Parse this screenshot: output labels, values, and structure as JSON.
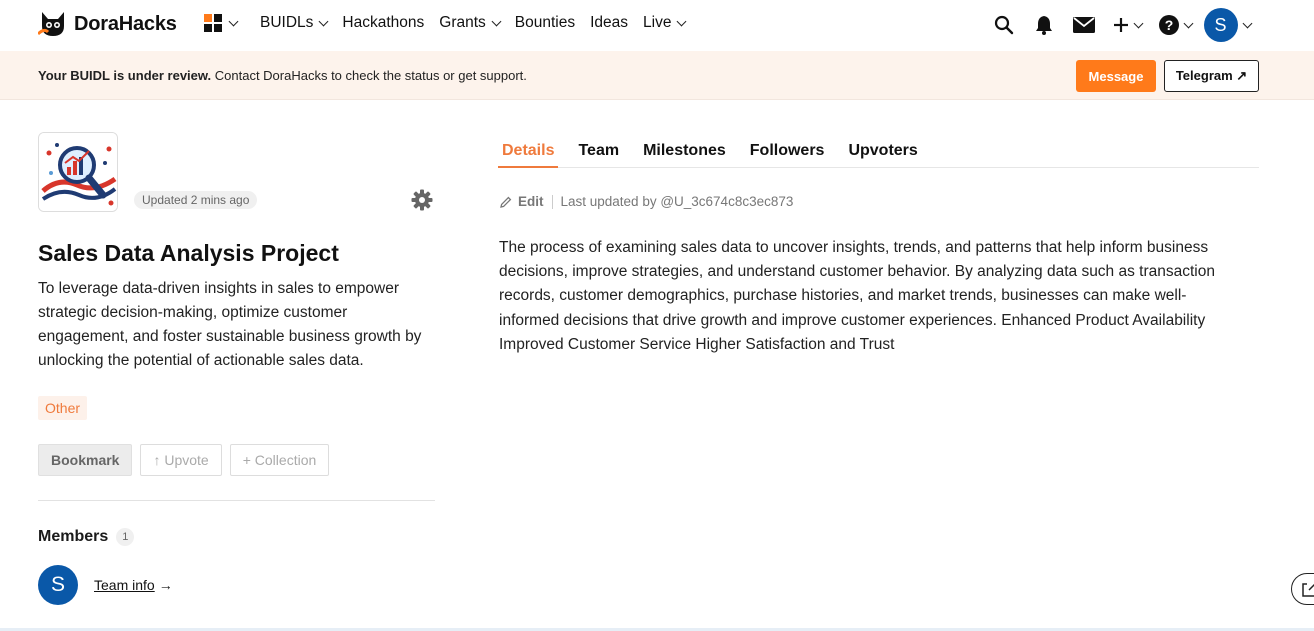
{
  "nav": {
    "brand": "DoraHacks",
    "links": [
      {
        "label": "BUIDLs",
        "dropdown": true
      },
      {
        "label": "Hackathons",
        "dropdown": false
      },
      {
        "label": "Grants",
        "dropdown": true
      },
      {
        "label": "Bounties",
        "dropdown": false
      },
      {
        "label": "Ideas",
        "dropdown": false
      },
      {
        "label": "Live",
        "dropdown": true
      }
    ],
    "avatar_letter": "S",
    "icons": [
      "search-icon",
      "bell-icon",
      "mail-icon",
      "plus-icon",
      "help-icon"
    ]
  },
  "banner": {
    "bold": "Your BUIDL is under review.",
    "text": " Contact DoraHacks to check the status or get support.",
    "message_btn": "Message",
    "telegram_btn": "Telegram ↗"
  },
  "project": {
    "updated": "Updated 2 mins ago",
    "title": "Sales Data Analysis Project",
    "description": "To leverage data-driven insights in sales to empower strategic decision-making, optimize customer engagement, and foster sustainable business growth by unlocking the potential of actionable sales data.",
    "tag": "Other",
    "buttons": {
      "bookmark": "Bookmark",
      "upvote": "↑ Upvote",
      "collection": "+ Collection"
    },
    "members_label": "Members",
    "members_count": "1",
    "member_letter": "S",
    "team_info": "Team info",
    "team_arrow": "→"
  },
  "tabs": [
    "Details",
    "Team",
    "Milestones",
    "Followers",
    "Upvoters"
  ],
  "active_tab": "Details",
  "details": {
    "edit": "Edit",
    "last_updated": "Last updated by @U_3c674c8c3ec873",
    "body": "The process of examining sales data to uncover insights, trends, and patterns that help inform business decisions, improve strategies, and understand customer behavior. By analyzing data such as transaction records, customer demographics, purchase histories, and market trends, businesses can make well-informed decisions that drive growth and improve customer experiences. Enhanced Product Availability Improved Customer Service Higher Satisfaction and Trust"
  },
  "colors": {
    "accent": "#ff7a1a",
    "tag_text": "#ef7a3c",
    "banner_bg": "#fdf3ec",
    "avatar_bg": "#0a58a8"
  }
}
